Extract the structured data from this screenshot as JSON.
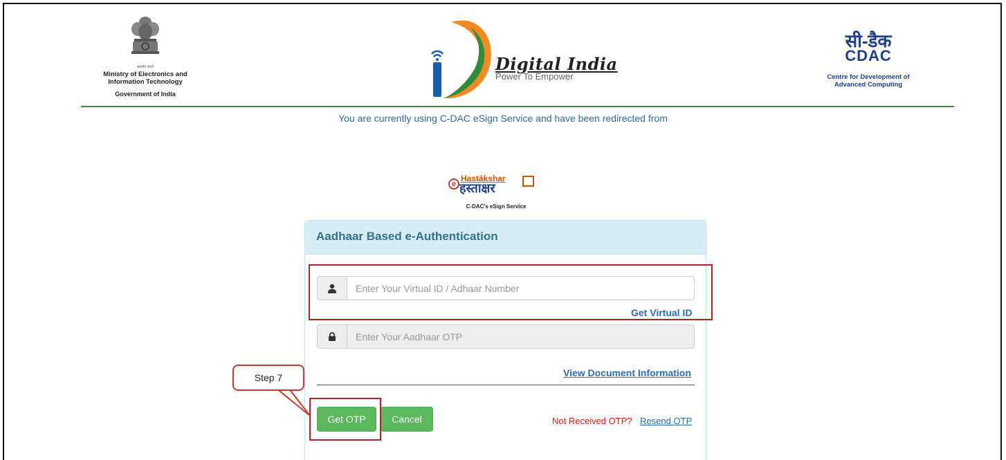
{
  "header": {
    "ministry": {
      "motto": "सत्यमेव जयते",
      "name": "Ministry of Electronics and Information Technology",
      "gov": "Government of India"
    },
    "digital_india": {
      "title": "Digital India",
      "tagline": "Power To Empower"
    },
    "cdac": {
      "hindi": "सी-डैक",
      "latin": "CDAC",
      "subtitle": "Centre for Development of Advanced Computing"
    }
  },
  "redirect_text": "You are currently using C-DAC eSign Service and have been redirected from",
  "service": {
    "name_en": "Hastākshar",
    "name_hi": "हस्ताक्षर",
    "caption": "C-DAC's eSign Service"
  },
  "panel": {
    "title": "Aadhaar Based e-Authentication",
    "virtual_id": {
      "placeholder": "Enter Your Virtual ID / Adhaar Number",
      "value": ""
    },
    "get_virtual_id": "Get Virtual ID",
    "otp": {
      "placeholder": "Enter Your Aadhaar OTP",
      "value": ""
    },
    "view_document": "View Document Information",
    "get_otp": "Get OTP",
    "cancel": "Cancel",
    "not_received": "Not Received OTP?",
    "resend": "Resend OTP"
  },
  "annotation": {
    "step_label": "Step 7",
    "highlight_color": "#b22222"
  },
  "icons": {
    "user_addon": "user-icon",
    "otp_addon": "lock-icon"
  }
}
